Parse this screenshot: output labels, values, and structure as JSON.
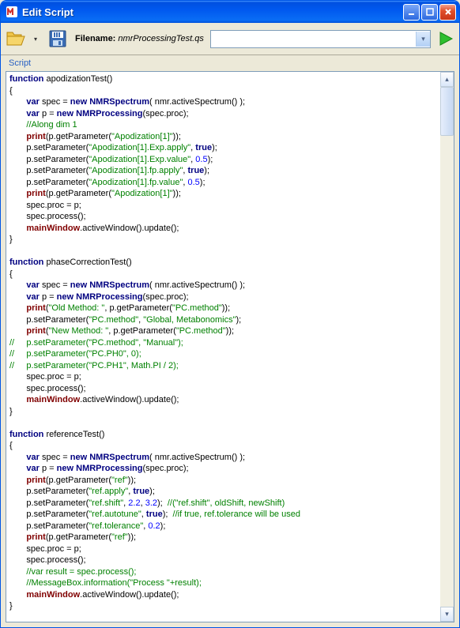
{
  "window": {
    "title": "Edit Script"
  },
  "toolbar": {
    "filename_label": "Filename:",
    "filename_value": "nmrProcessingTest.qs"
  },
  "section_label": "Script",
  "icons": {
    "app": "m-logo",
    "open": "folder-open-icon",
    "save": "floppy-icon",
    "run": "play-icon",
    "minimize": "_",
    "maximize": "□",
    "close": "×",
    "dropdown": "▾",
    "scroll_up": "▴",
    "scroll_down": "▾"
  },
  "code": {
    "fn1": "apodizationTest",
    "fn2": "phaseCorrectionTest",
    "fn3": "referenceTest",
    "var_spec": "var",
    "kw_function": "function",
    "kw_new": "new",
    "kw_true": "true",
    "t_NMRSpectrum": "NMRSpectrum",
    "t_NMRProcessing": "NMRProcessing",
    "id_print": "print",
    "id_mainWindow": "mainWindow",
    "s_apod1": "\"Apodization[1]\"",
    "s_apod1ExpApply": "\"Apodization[1].Exp.apply\"",
    "s_apod1ExpValue": "\"Apodization[1].Exp.value\"",
    "s_apod1FpApply": "\"Apodization[1].fp.apply\"",
    "s_apod1FpValue": "\"Apodization[1].fp.value\"",
    "s_OldMethod": "\"Old Method: \"",
    "s_NewMethod": "\"New Method: \"",
    "s_PCmethod": "\"PC.method\"",
    "s_Global": "\"Global, Metabonomics\"",
    "s_Manual": "\"Manual\"",
    "s_PCPH0": "\"PC.PH0\"",
    "s_PCPH1": "\"PC.PH1\"",
    "s_ref": "\"ref\"",
    "s_refApply": "\"ref.apply\"",
    "s_refShift": "\"ref.shift\"",
    "s_refAutotune": "\"ref.autotune\"",
    "s_refTol": "\"ref.tolerance\"",
    "c_alongDim1": "//Along dim 1",
    "c_refShift": "//(\"ref.shift\", oldShift, newShift)",
    "c_ifTrue": "//if true, ref.tolerance will be used",
    "c_varResult": "//var result = spec.process();",
    "c_msgBox": "//MessageBox.information(\"Process \"+result);",
    "c_pcManual": "//     p.setParameter(\"PC.method\", \"Manual\");",
    "c_pcPH0": "//     p.setParameter(\"PC.PH0\", 0);",
    "c_pcPH1": "//     p.setParameter(\"PC.PH1\", Math.PI / 2);",
    "n_05": "0.5",
    "n_0": "0",
    "n_22": "2.2",
    "n_32": "3.2",
    "n_02": "0.2",
    "n_2": "2"
  }
}
